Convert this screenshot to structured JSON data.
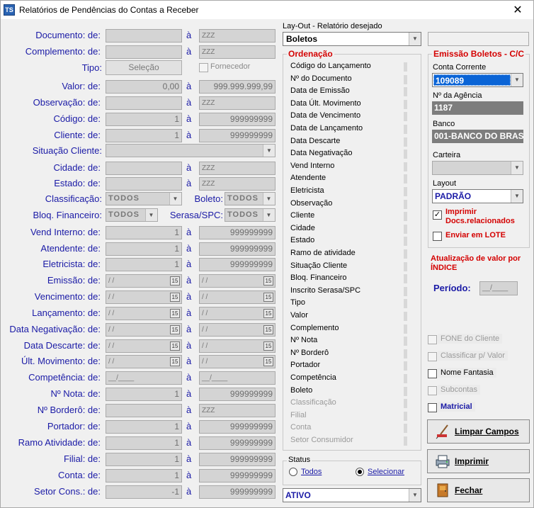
{
  "window": {
    "title": "Relatórios de Pendências do Contas a Receber",
    "icon_text": "TS",
    "close_glyph": "✕"
  },
  "separator_a": "à",
  "fields": [
    {
      "id": "documento",
      "label": "Documento: de:",
      "from": "",
      "to": "ZZZ"
    },
    {
      "id": "complemento",
      "label": "Complemento: de:",
      "from": "",
      "to": "ZZZ"
    },
    {
      "id": "valor",
      "label": "Valor: de:",
      "from": "0,00",
      "to": "999.999.999,99"
    },
    {
      "id": "observacao",
      "label": "Observação: de:",
      "from": "",
      "to": "ZZZ"
    },
    {
      "id": "codigo",
      "label": "Código: de:",
      "from": "1",
      "to": "999999999"
    },
    {
      "id": "cliente",
      "label": "Cliente: de:",
      "from": "1",
      "to": "999999999"
    },
    {
      "id": "cidade",
      "label": "Cidade: de:",
      "from": "",
      "to": "ZZZ"
    },
    {
      "id": "estado",
      "label": "Estado: de:",
      "from": "",
      "to": "ZZZ"
    },
    {
      "id": "vend_interno",
      "label": "Vend Interno: de:",
      "from": "1",
      "to": "999999999"
    },
    {
      "id": "atendente",
      "label": "Atendente: de:",
      "from": "1",
      "to": "999999999"
    },
    {
      "id": "eletricista",
      "label": "Eletricista: de:",
      "from": "1",
      "to": "999999999"
    },
    {
      "id": "emissao",
      "label": "Emissão: de:",
      "from": "/ /",
      "to": "/ /"
    },
    {
      "id": "vencimento",
      "label": "Vencimento: de:",
      "from": "/ /",
      "to": "/ /"
    },
    {
      "id": "lancamento",
      "label": "Lançamento: de:",
      "from": "/ /",
      "to": "/ /"
    },
    {
      "id": "data_negativacao",
      "label": "Data Negativação: de:",
      "from": "/ /",
      "to": "/ /"
    },
    {
      "id": "data_descarte",
      "label": "Data Descarte: de:",
      "from": "/ /",
      "to": "/ /"
    },
    {
      "id": "ult_movimento",
      "label": "Últ. Movimento: de:",
      "from": "/ /",
      "to": "/ /"
    },
    {
      "id": "competencia",
      "label": "Competência: de:",
      "from": "__/____",
      "to": "__/____"
    },
    {
      "id": "num_nota",
      "label": "Nº Nota: de:",
      "from": "1",
      "to": "999999999"
    },
    {
      "id": "num_bordero",
      "label": "Nº Borderô: de:",
      "from": "",
      "to": "ZZZ"
    },
    {
      "id": "portador",
      "label": "Portador: de:",
      "from": "1",
      "to": "999999999"
    },
    {
      "id": "ramo_atividade",
      "label": "Ramo Atividade: de:",
      "from": "1",
      "to": "999999999"
    },
    {
      "id": "filial",
      "label": "Filial: de:",
      "from": "1",
      "to": "999999999"
    },
    {
      "id": "conta",
      "label": "Conta: de:",
      "from": "1",
      "to": "999999999"
    },
    {
      "id": "setor_cons",
      "label": "Setor Cons.: de:",
      "from": "-1",
      "to": "999999999"
    }
  ],
  "tipo": {
    "label": "Tipo:",
    "button": "Seleção",
    "fornecedor": "Fornecedor"
  },
  "situacao_cliente": {
    "label": "Situação Cliente:",
    "value": ""
  },
  "classificacao": {
    "label": "Classificação:",
    "value": "TODOS"
  },
  "boleto": {
    "label": "Boleto:",
    "value": "TODOS"
  },
  "bloq_financeiro": {
    "label": "Bloq. Financeiro:",
    "value": "TODOS"
  },
  "serasa": {
    "label": "Serasa/SPC:",
    "value": "TODOS"
  },
  "layout_select": {
    "label": "Lay-Out - Relatório desejado",
    "value": "Boletos"
  },
  "ordenacao": {
    "title": "Ordenação",
    "items": [
      {
        "label": "Código do Lançamento",
        "enabled": true
      },
      {
        "label": "Nº do Documento",
        "enabled": true
      },
      {
        "label": "Data de Emissão",
        "enabled": true
      },
      {
        "label": "Data Últ. Movimento",
        "enabled": true
      },
      {
        "label": "Data de Vencimento",
        "enabled": true
      },
      {
        "label": "Data de Lançamento",
        "enabled": true
      },
      {
        "label": "Data Descarte",
        "enabled": true
      },
      {
        "label": "Data Negativação",
        "enabled": true
      },
      {
        "label": "Vend Interno",
        "enabled": true
      },
      {
        "label": "Atendente",
        "enabled": true
      },
      {
        "label": "Eletricista",
        "enabled": true
      },
      {
        "label": "Observação",
        "enabled": true
      },
      {
        "label": "Cliente",
        "enabled": true
      },
      {
        "label": "Cidade",
        "enabled": true
      },
      {
        "label": "Estado",
        "enabled": true
      },
      {
        "label": "Ramo de atividade",
        "enabled": true
      },
      {
        "label": "Situação Cliente",
        "enabled": true
      },
      {
        "label": "Bloq. Financeiro",
        "enabled": true
      },
      {
        "label": "Inscrito Serasa/SPC",
        "enabled": true
      },
      {
        "label": "Tipo",
        "enabled": true
      },
      {
        "label": "Valor",
        "enabled": true
      },
      {
        "label": "Complemento",
        "enabled": true
      },
      {
        "label": "Nº Nota",
        "enabled": true
      },
      {
        "label": "Nº Borderô",
        "enabled": true
      },
      {
        "label": "Portador",
        "enabled": true
      },
      {
        "label": "Competência",
        "enabled": true
      },
      {
        "label": "Boleto",
        "enabled": true
      },
      {
        "label": "Classificação",
        "enabled": false
      },
      {
        "label": "Filial",
        "enabled": false
      },
      {
        "label": "Conta",
        "enabled": false
      },
      {
        "label": "Setor Consumidor",
        "enabled": false
      }
    ]
  },
  "status": {
    "title": "Status",
    "todos": "Todos",
    "selecionar": "Selecionar",
    "selected": "selecionar",
    "value": "ATIVO"
  },
  "emissao_boletos": {
    "title": "Emissão Boletos - C/C",
    "conta_corrente_label": "Conta Corrente",
    "conta_corrente": "109089",
    "agencia_label": "Nº da Agência",
    "agencia": "1187",
    "banco_label": "Banco",
    "banco": "001-BANCO DO BRAS",
    "carteira_label": "Carteira",
    "carteira": "",
    "layout_label": "Layout",
    "layout": "PADRÃO",
    "imprimir_docs": "Imprimir Docs.relacionados",
    "imprimir_docs_checked": true,
    "enviar_lote": "Enviar em LOTE",
    "enviar_lote_checked": false
  },
  "atualizacao": {
    "title": "Atualização de valor por ÍNDICE",
    "periodo_label": "Período:",
    "periodo": "__/____"
  },
  "options": [
    {
      "label": "FONE do Cliente",
      "checked": false,
      "enabled": false
    },
    {
      "label": "Classificar p/ Valor",
      "checked": false,
      "enabled": false
    },
    {
      "label": "Nome Fantasia",
      "checked": false,
      "enabled": true
    },
    {
      "label": "Subcontas",
      "checked": false,
      "enabled": false
    },
    {
      "label": "Matricial",
      "checked": false,
      "enabled": true
    }
  ],
  "buttons": {
    "limpar": "Limpar Campos",
    "imprimir": "Imprimir",
    "fechar": "Fechar"
  },
  "colors": {
    "label_blue": "#1a1aa6",
    "red": "#d40000",
    "selection": "#0a64d6",
    "field_disabled": "#d4d4d4"
  }
}
